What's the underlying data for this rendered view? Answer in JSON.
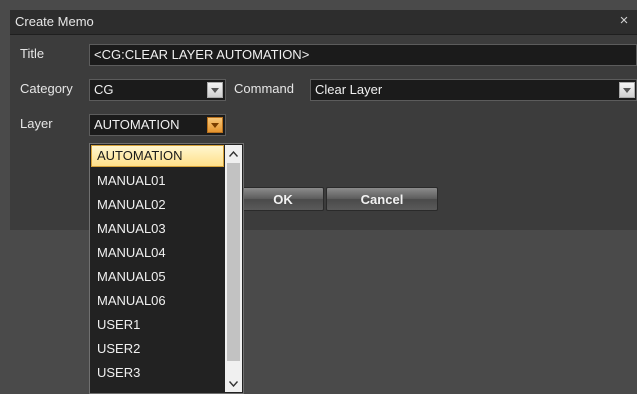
{
  "dialog": {
    "title": "Create Memo",
    "close_glyph": "×",
    "fields": {
      "title_label": "Title",
      "title_value": "<CG:CLEAR LAYER AUTOMATION>",
      "category_label": "Category",
      "category_value": "CG",
      "command_label": "Command",
      "command_value": "Clear Layer",
      "layer_label": "Layer",
      "layer_value": "AUTOMATION"
    },
    "buttons": {
      "ok": "OK",
      "cancel": "Cancel"
    }
  },
  "layer_dropdown": {
    "selected": "AUTOMATION",
    "options": [
      "AUTOMATION",
      "MANUAL01",
      "MANUAL02",
      "MANUAL03",
      "MANUAL04",
      "MANUAL05",
      "MANUAL06",
      "USER1",
      "USER2",
      "USER3"
    ]
  },
  "icons": {
    "dropdown": "chevron-down-icon",
    "scroll_up": "chevron-up-icon",
    "scroll_down": "chevron-down-icon"
  },
  "colors": {
    "selection_fill": "#ffe08a",
    "active_dropdown_button": "#e6952f",
    "dialog_background": "#3c3c3c"
  }
}
